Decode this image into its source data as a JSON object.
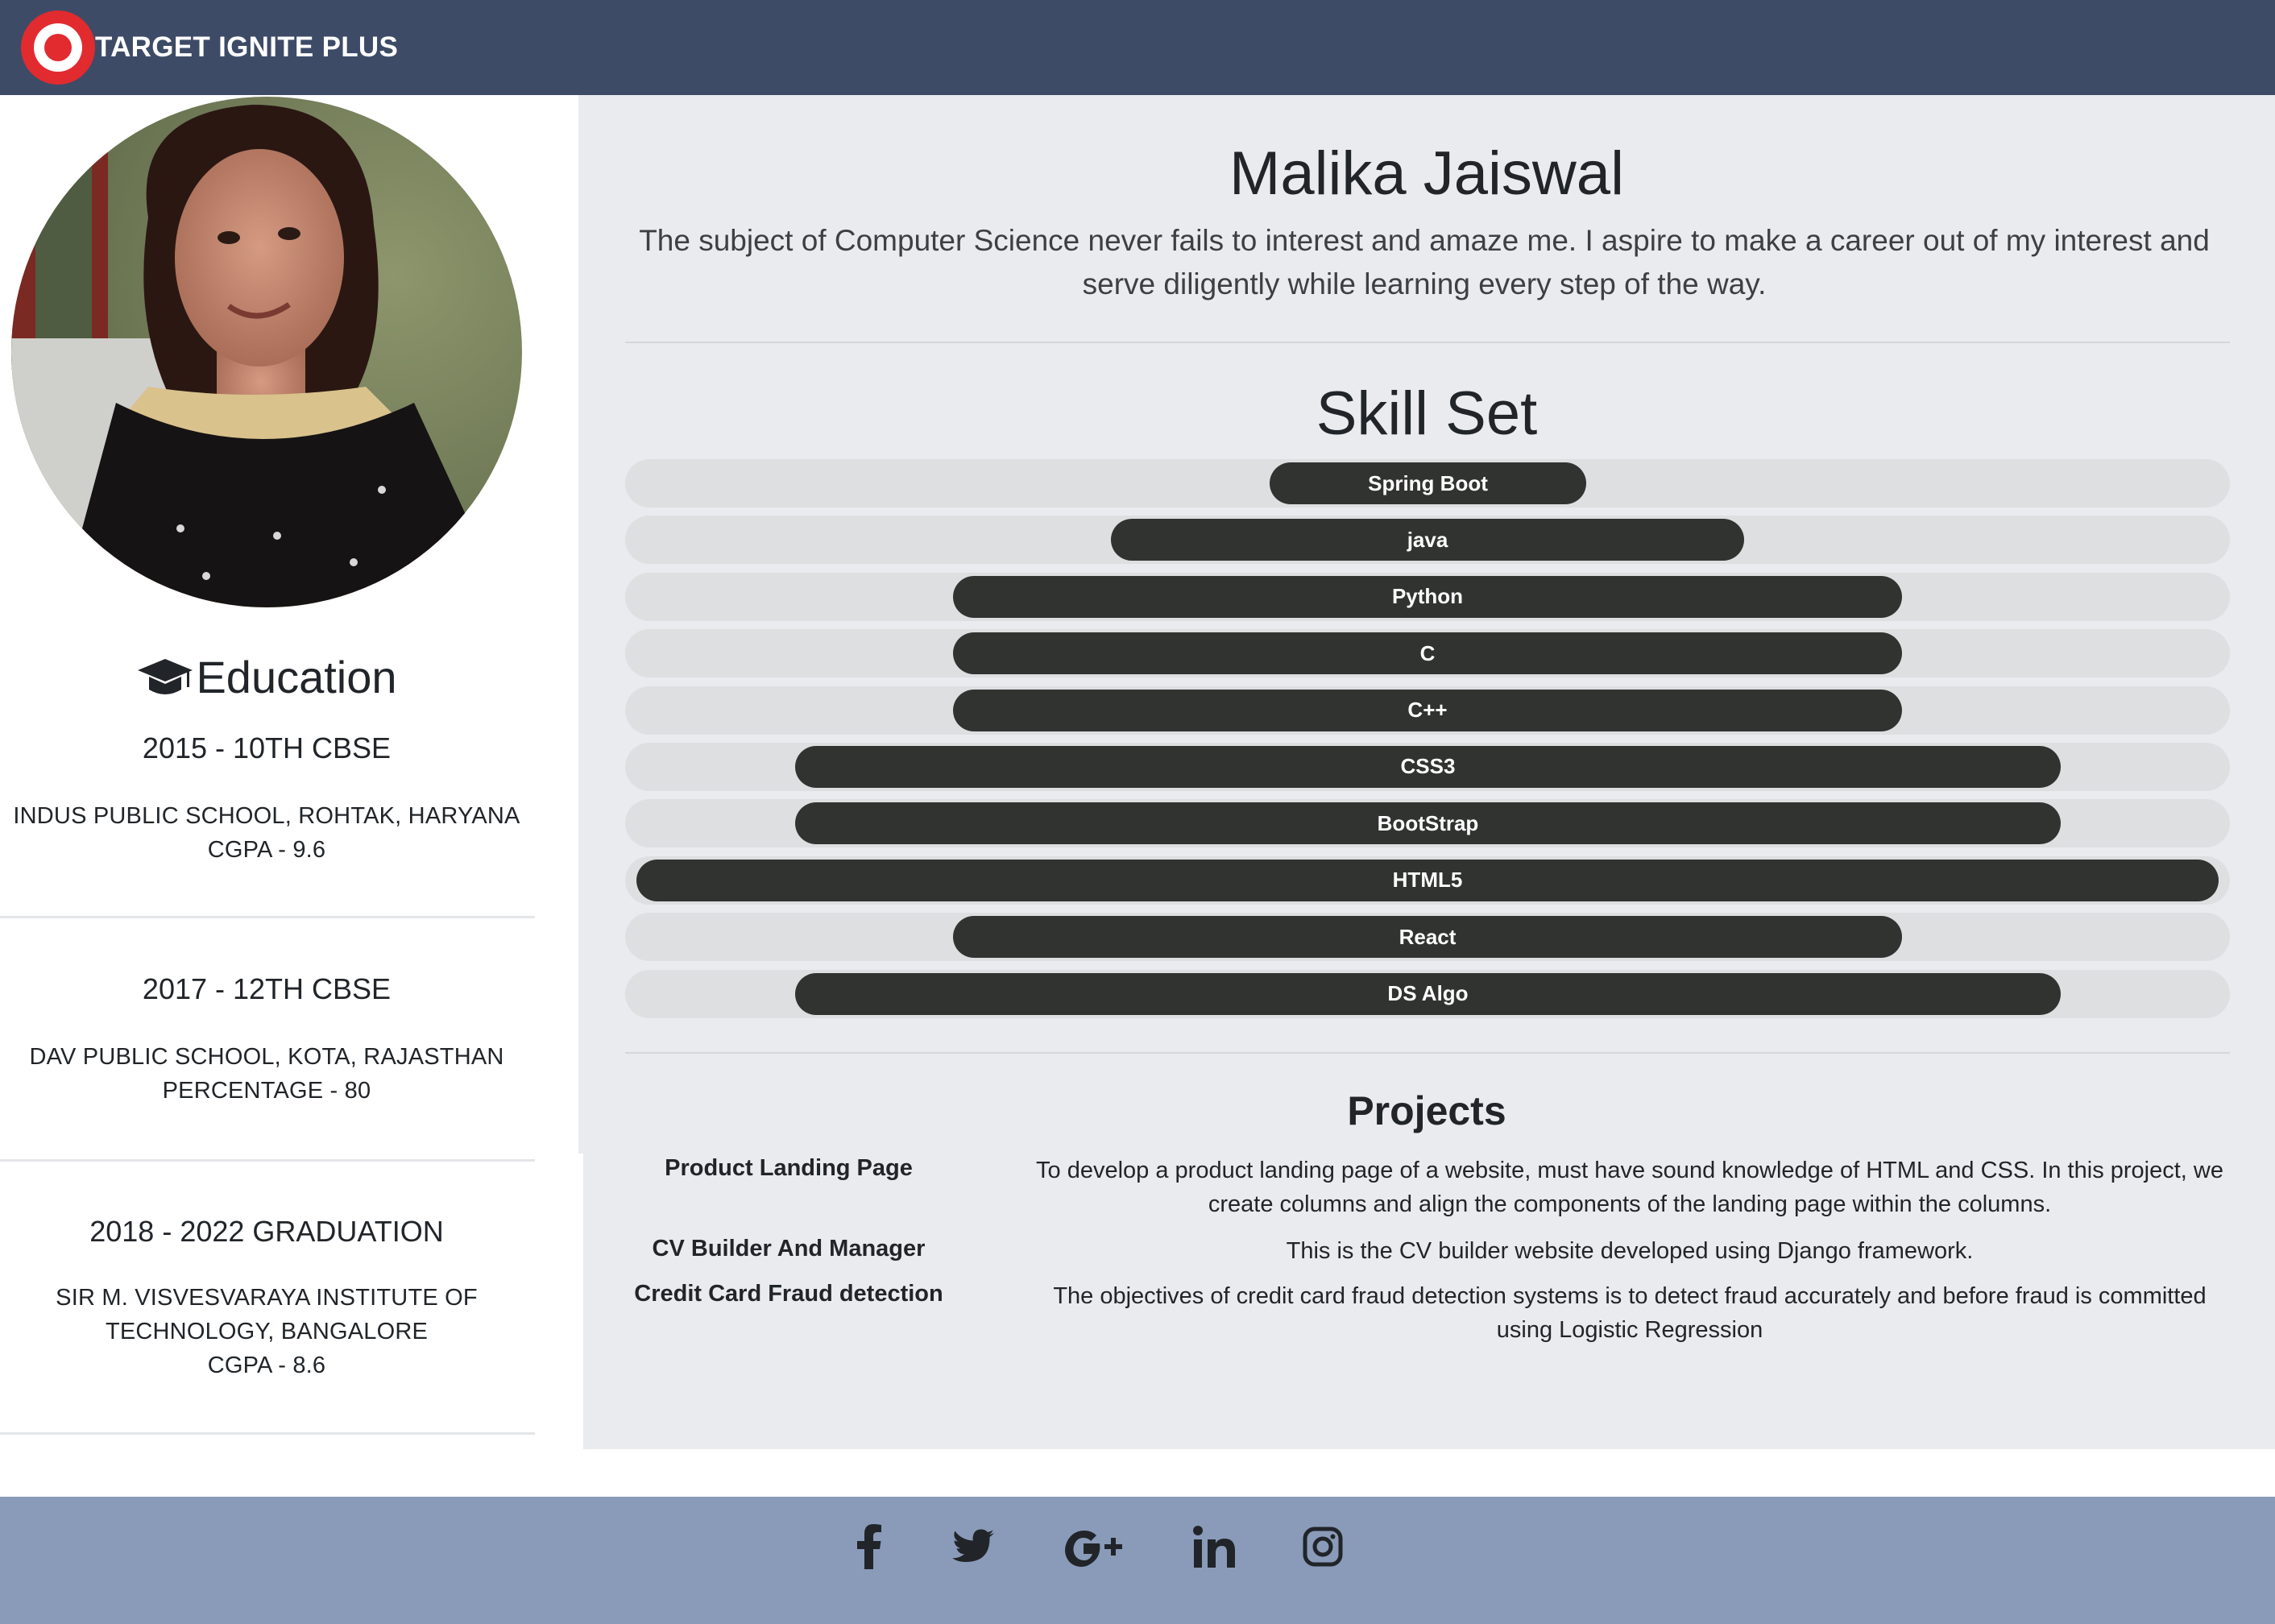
{
  "navbar": {
    "brand": "TARGET IGNITE PLUS",
    "logo_icon": "target-logo-icon",
    "colors": {
      "background": "#3d4b67",
      "logo_red": "#e12b2f"
    }
  },
  "profile": {
    "photo_icon": "profile-photo",
    "name": "Malika Jaiswal",
    "summary": "The subject of Computer Science never fails to interest and amaze me. I aspire to make a career out of my interest and serve diligently while learning every step of the way."
  },
  "education": {
    "heading": "Education",
    "heading_icon": "graduation-cap-icon",
    "entries": [
      {
        "title": "2015 - 10TH CBSE",
        "lines": [
          "INDUS PUBLIC SCHOOL, ROHTAK, HARYANA",
          "CGPA - 9.6"
        ]
      },
      {
        "title": "2017 - 12TH CBSE",
        "lines": [
          "DAV PUBLIC SCHOOL, KOTA, RAJASTHAN",
          "PERCENTAGE - 80"
        ]
      },
      {
        "title": "2018 - 2022 GRADUATION",
        "lines": [
          "SIR M. VISVESVARAYA INSTITUTE OF",
          "TECHNOLOGY, BANGALORE",
          "CGPA - 8.6"
        ]
      }
    ]
  },
  "skills": {
    "heading": "Skill Set",
    "bar_color": "#313331",
    "track_color": "#dedfe1",
    "items": [
      {
        "label": "Spring Boot",
        "level": 0.2
      },
      {
        "label": "java",
        "level": 0.4
      },
      {
        "label": "Python",
        "level": 0.6
      },
      {
        "label": "C",
        "level": 0.6
      },
      {
        "label": "C++",
        "level": 0.6
      },
      {
        "label": "CSS3",
        "level": 0.8
      },
      {
        "label": "BootStrap",
        "level": 0.8
      },
      {
        "label": "HTML5",
        "level": 1.0
      },
      {
        "label": "React",
        "level": 0.6
      },
      {
        "label": "DS Algo",
        "level": 0.8
      }
    ]
  },
  "projects": {
    "heading": "Projects",
    "items": [
      {
        "name": "Product Landing Page",
        "description": "To develop a product landing page of a website, must have sound knowledge of HTML and CSS. In this project, we create columns and align the components of the landing page within the columns."
      },
      {
        "name": "CV Builder And Manager",
        "description": "This is the CV builder website developed using Django framework."
      },
      {
        "name": "Credit Card Fraud detection",
        "description": "The objectives of credit card fraud detection systems is to detect fraud accurately and before fraud is committed using Logistic Regression"
      }
    ]
  },
  "footer": {
    "background": "#8a9bb9",
    "social_icons": [
      "facebook-icon",
      "twitter-icon",
      "google-plus-icon",
      "linkedin-icon",
      "instagram-icon"
    ]
  }
}
